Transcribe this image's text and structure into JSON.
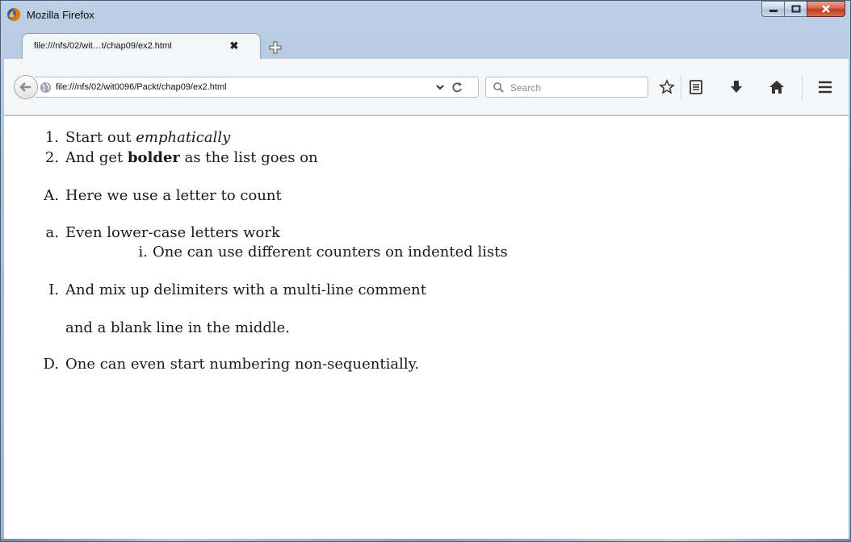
{
  "window": {
    "title": "Mozilla Firefox"
  },
  "tab": {
    "label": "file:///nfs/02/wit…t/chap09/ex2.html",
    "close_glyph": "✖",
    "newtab_icon": "plus-icon"
  },
  "navbar": {
    "url": "file:///nfs/02/wit0096/Packt/chap09/ex2.html",
    "search_placeholder": "Search",
    "icons": [
      "back-arrow-icon",
      "globe-icon",
      "dropdown-icon",
      "reload-icon",
      "search-icon",
      "bookmark-star-icon",
      "reading-list-icon",
      "download-icon",
      "home-icon",
      "menu-icon"
    ]
  },
  "content": {
    "list1": [
      {
        "marker": "1.",
        "pre": "Start out ",
        "emph": "emphatically",
        "post": ""
      },
      {
        "marker": "2.",
        "pre": "And get ",
        "strong": "bolder",
        "post": " as the list goes on"
      }
    ],
    "list2": [
      {
        "marker": "A.",
        "text": "Here we use a letter to count"
      }
    ],
    "list3": [
      {
        "marker": "a.",
        "text": "Even lower-case letters work"
      },
      {
        "marker": "i.",
        "text": "One can use different counters on indented lists"
      }
    ],
    "list4": [
      {
        "marker": "I.",
        "text": "And mix up delimiters with a multi-line comment",
        "continuation": "and a blank line in the middle."
      }
    ],
    "list5": [
      {
        "marker": "D.",
        "text": "One can even start numbering non-sequentially."
      }
    ]
  },
  "colors": {
    "chrome_blue": "#a9c1dc",
    "toolbar_bg": "#f5f6f7",
    "close_red": "#c0391f",
    "text": "#1a1a1a"
  }
}
